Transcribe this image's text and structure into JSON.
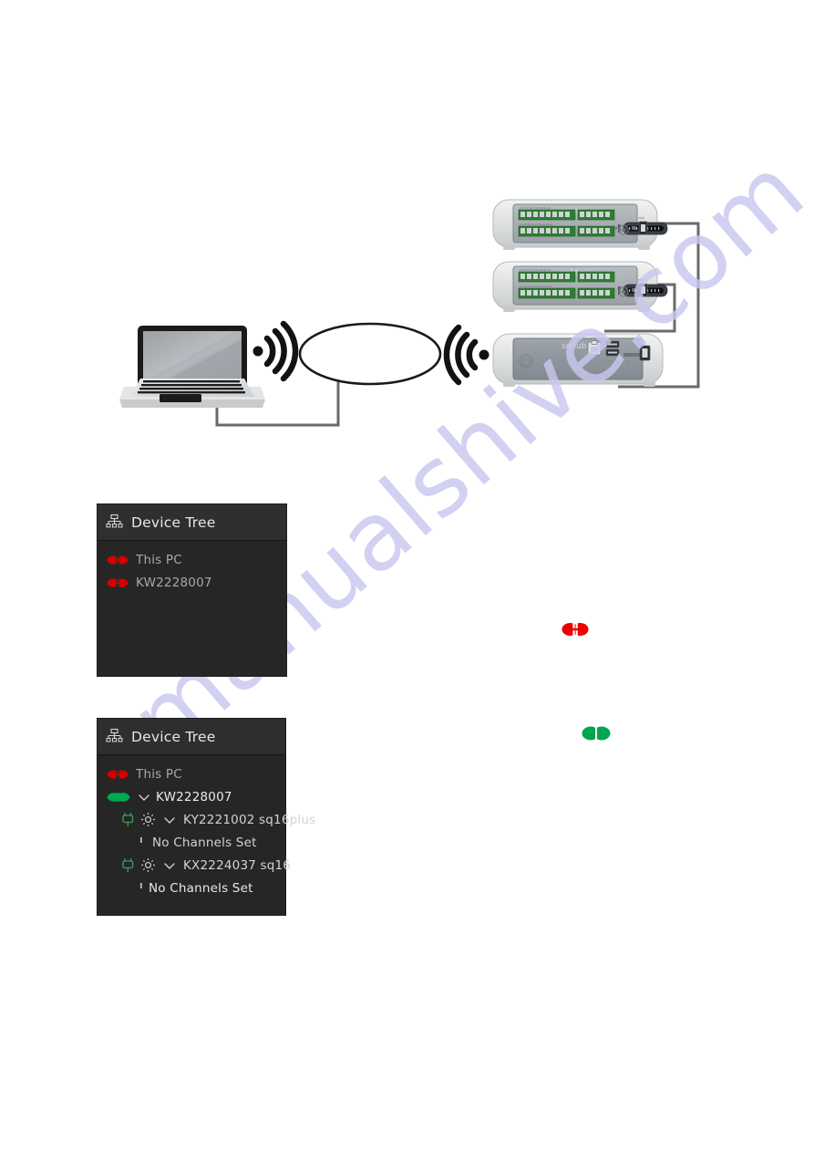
{
  "watermark": {
    "text": "manualshive.com"
  },
  "diagram": {
    "name": "network-topology-diagram",
    "laptop": {
      "label": "laptop"
    },
    "cloud": {
      "label": "network-cloud"
    },
    "wifi_left": {
      "label": "wifi-signal-from-laptop"
    },
    "wifi_right": {
      "label": "wifi-signal-to-hub"
    },
    "devices": [
      {
        "id": "device-sq16plus-top",
        "model": "sq16plus"
      },
      {
        "id": "device-sq16plus-mid",
        "model": "sq16plus"
      },
      {
        "id": "device-sqhub",
        "model": "sqhub"
      }
    ]
  },
  "status_icons": {
    "disconnected": {
      "name": "disconnected-plug-icon",
      "color": "#ee0000"
    },
    "connected": {
      "name": "connected-plug-icon",
      "color": "#00a650"
    }
  },
  "tree_panel_1": {
    "header": {
      "title": "Device Tree",
      "icon": "hierarchy-icon"
    },
    "rows": [
      {
        "label": "This PC",
        "icon": "disconnected-plug-icon",
        "status": "disconnected",
        "indent": 0
      },
      {
        "label": "KW2228007",
        "icon": "disconnected-plug-icon",
        "status": "disconnected",
        "indent": 0
      }
    ]
  },
  "tree_panel_2": {
    "header": {
      "title": "Device Tree",
      "icon": "hierarchy-icon"
    },
    "rows": [
      {
        "label": "This PC",
        "icon": "disconnected-plug-icon",
        "status": "disconnected",
        "indent": 0
      },
      {
        "label": "KW2228007",
        "icon": "connected-plug-icon",
        "status": "connected",
        "indent": 0,
        "expanded": true
      },
      {
        "label": "KY2221002 sq16plus",
        "icon": "plug-outline-icon",
        "status": "connected",
        "indent": 1,
        "expanded": true
      },
      {
        "label": "No Channels Set",
        "icon": "tick-marker",
        "indent": 2
      },
      {
        "label": "KX2224037 sq16",
        "icon": "plug-outline-icon",
        "status": "connected",
        "indent": 1,
        "expanded": true
      },
      {
        "label": "No Channels Set",
        "icon": "tick-marker",
        "indent": 2
      }
    ]
  }
}
